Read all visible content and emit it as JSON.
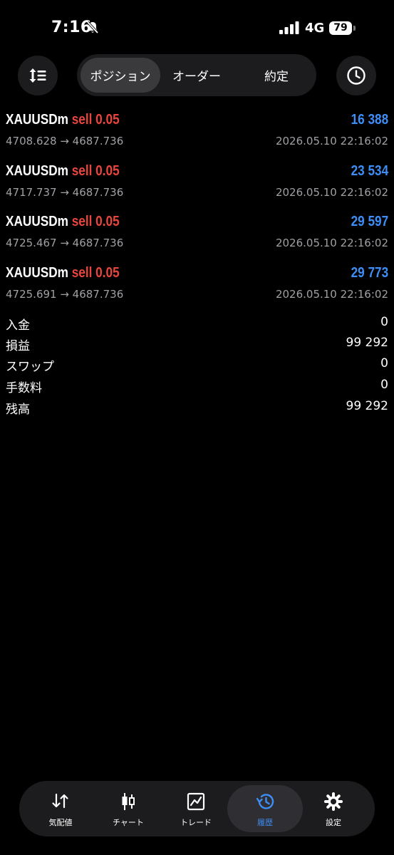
{
  "status_bar": {
    "time": "7:16",
    "network": "4G",
    "battery": "79",
    "icons": [
      "bell-slash-icon",
      "signal-icon",
      "battery-icon"
    ]
  },
  "top_controls": {
    "sort_icon": "sort-icon",
    "history_icon": "clock-icon",
    "tabs": [
      {
        "label": "ポジション",
        "active": true
      },
      {
        "label": "オーダー",
        "active": false
      },
      {
        "label": "約定",
        "active": false
      }
    ]
  },
  "trades": [
    {
      "symbol": "XAUUSDm",
      "side": "sell 0.05",
      "profit": "16 388",
      "prices": "4708.628 → 4687.736",
      "time": "2026.05.10 22:16:02"
    },
    {
      "symbol": "XAUUSDm",
      "side": "sell 0.05",
      "profit": "23 534",
      "prices": "4717.737 → 4687.736",
      "time": "2026.05.10 22:16:02"
    },
    {
      "symbol": "XAUUSDm",
      "side": "sell 0.05",
      "profit": "29 597",
      "prices": "4725.467 → 4687.736",
      "time": "2026.05.10 22:16:02"
    },
    {
      "symbol": "XAUUSDm",
      "side": "sell 0.05",
      "profit": "29 773",
      "prices": "4725.691 → 4687.736",
      "time": "2026.05.10 22:16:02"
    }
  ],
  "summary": [
    {
      "label": "入金",
      "value": "0"
    },
    {
      "label": "損益",
      "value": "99 292"
    },
    {
      "label": "スワップ",
      "value": "0"
    },
    {
      "label": "手数料",
      "value": "0"
    },
    {
      "label": "残高",
      "value": "99 292"
    }
  ],
  "bottom_nav": {
    "items": [
      {
        "label": "気配値",
        "icon": "quotes-arrows-icon",
        "active": false
      },
      {
        "label": "チャート",
        "icon": "candlestick-chart-icon",
        "active": false
      },
      {
        "label": "トレード",
        "icon": "trade-chart-icon",
        "active": false
      },
      {
        "label": "履歴",
        "icon": "history-icon",
        "active": true
      },
      {
        "label": "設定",
        "icon": "settings-gear-icon",
        "active": false
      }
    ]
  },
  "colors": {
    "background": "#000000",
    "sell": "#e8463c",
    "profit": "#3e8ef7",
    "muted": "#a0a0a5",
    "surface": "#1c1c1e"
  }
}
